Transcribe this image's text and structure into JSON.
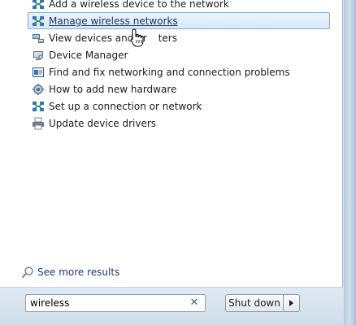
{
  "results": [
    {
      "label": "Add a wireless device to the network",
      "icon": "network-icon",
      "selected": false
    },
    {
      "label": "Manage wireless networks",
      "icon": "network-icon",
      "selected": true
    },
    {
      "label": "View devices and pr",
      "label_after_cursor": "ters",
      "icon": "devices-icon",
      "selected": false
    },
    {
      "label": "Device Manager",
      "icon": "device-manager-icon",
      "selected": false
    },
    {
      "label": "Find and fix networking and connection problems",
      "icon": "troubleshoot-icon",
      "selected": false
    },
    {
      "label": "How to add new hardware",
      "icon": "help-gear-icon",
      "selected": false
    },
    {
      "label": "Set up a connection or network",
      "icon": "network-icon",
      "selected": false
    },
    {
      "label": "Update device drivers",
      "icon": "printer-icon",
      "selected": false
    }
  ],
  "see_more": {
    "label": "See more results",
    "icon": "search-icon"
  },
  "search": {
    "value": "wireless",
    "clear_icon": "clear-icon"
  },
  "shutdown": {
    "label": "Shut down",
    "arrow_icon": "arrow-right-icon"
  },
  "colors": {
    "selection_border": "#87acd1",
    "link": "#1e3a66",
    "frame": "#cfdeeb"
  }
}
